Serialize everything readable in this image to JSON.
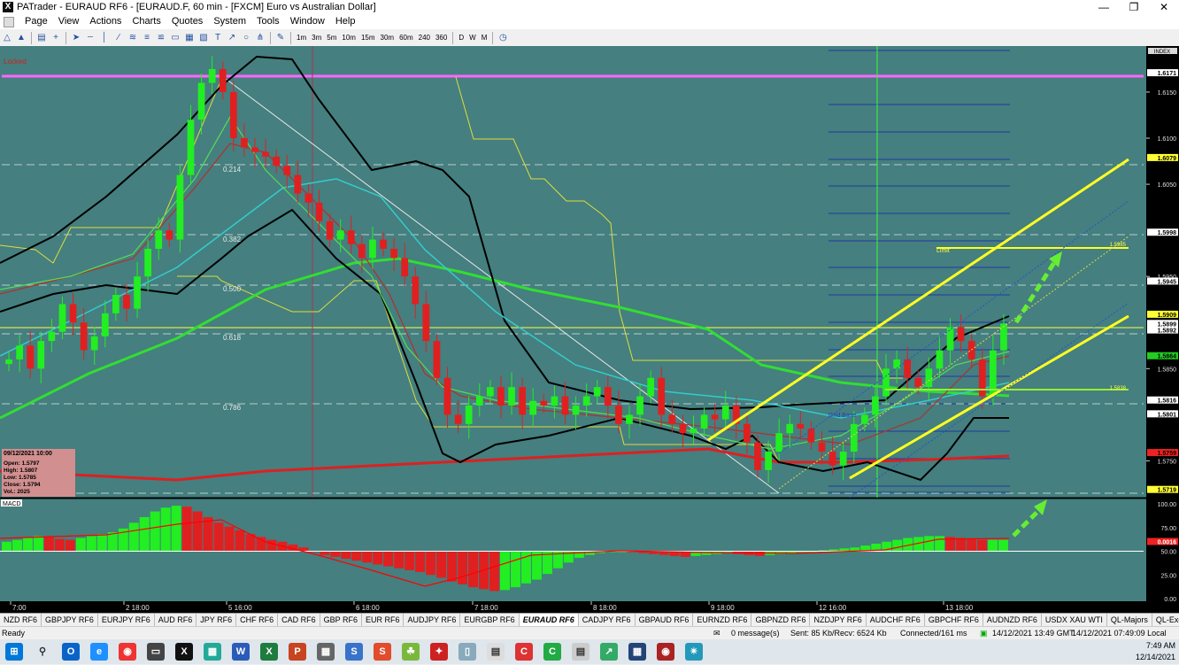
{
  "window": {
    "title": "PATrader - EURAUD RF6 - [EURAUD.F, 60 min - [FXCM] Euro vs Australian Dollar]"
  },
  "menu": [
    "Page",
    "View",
    "Actions",
    "Charts",
    "Quotes",
    "System",
    "Tools",
    "Window",
    "Help"
  ],
  "toolbar": {
    "timeframes": [
      "1m",
      "3m",
      "5m",
      "10m",
      "15m",
      "30m",
      "60m",
      "240",
      "360",
      "D",
      "W",
      "M"
    ]
  },
  "colors": {
    "chart_bg": "#457f7f",
    "bull": "#22ee22",
    "bear": "#e02020",
    "bollinger": "#000000",
    "ma_green": "#33dd33",
    "ma_red": "#dd2020",
    "channel": "#ffff22",
    "macd_line": "#ff0000"
  },
  "chart_data": {
    "type": "candlestick",
    "symbol": "EURAUD.F",
    "timeframe": "60 min",
    "ylim": [
      1.5712,
      1.6198
    ],
    "price_ticks": [
      "1.6150",
      "1.6100",
      "1.6050",
      "1.5950",
      "1.5850",
      "1.5750"
    ],
    "x_ticks": [
      "7:00",
      "2 18:00",
      "5 16:00",
      "6 18:00",
      "7 18:00",
      "8 18:00",
      "9 18:00",
      "12 16:00",
      "13 18:00"
    ],
    "badges": [
      {
        "value": "1.6171",
        "bg": "#ffffff"
      },
      {
        "value": "1.6079",
        "bg": "#ffff33"
      },
      {
        "value": "1.5998",
        "bg": "#ffffff"
      },
      {
        "value": "1.5945",
        "bg": "#ffffff"
      },
      {
        "value": "1.5909",
        "bg": "#ffff33"
      },
      {
        "value": "1.5899",
        "bg": "#ffffff"
      },
      {
        "value": "1.5892",
        "bg": "#ffffff"
      },
      {
        "value": "1.5864",
        "bg": "#22cc22"
      },
      {
        "value": "1.5816",
        "bg": "#ffffff"
      },
      {
        "value": "1.5801",
        "bg": "#ffffff"
      },
      {
        "value": "1.5759",
        "bg": "#ee2222"
      },
      {
        "value": "1.5719",
        "bg": "#ffff33"
      }
    ],
    "fib_labels": [
      "0.214",
      "0.382",
      "0.500",
      "0.618",
      "0.786"
    ],
    "level_labels": {
      "limit": "Limit",
      "limit_value": "1.5985",
      "mid_value": "1.5838",
      "grid_base": "Grid Base",
      "locked": "Locked",
      "index": "INDEX"
    },
    "candles": [
      1.586,
      1.5875,
      1.585,
      1.588,
      1.589,
      1.592,
      1.59,
      1.587,
      1.5885,
      1.591,
      1.593,
      1.5915,
      1.595,
      1.598,
      1.6,
      1.599,
      1.606,
      1.612,
      1.616,
      1.6175,
      1.615,
      1.61,
      1.609,
      1.6085,
      1.608,
      1.607,
      1.606,
      1.604,
      1.603,
      1.601,
      1.599,
      1.6,
      1.5985,
      1.597,
      1.599,
      1.598,
      1.597,
      1.595,
      1.592,
      1.588,
      1.584,
      1.58,
      1.579,
      1.581,
      1.582,
      1.583,
      1.581,
      1.583,
      1.58,
      1.5815,
      1.581,
      1.582,
      1.58,
      1.581,
      1.582,
      1.583,
      1.581,
      1.579,
      1.58,
      1.582,
      1.584,
      1.58,
      1.579,
      1.578,
      1.5785,
      1.58,
      1.5795,
      1.581,
      1.579,
      1.577,
      1.574,
      1.576,
      1.578,
      1.579,
      1.5785,
      1.577,
      1.576,
      1.5745,
      1.576,
      1.579,
      1.58,
      1.582,
      1.585,
      1.586,
      1.584,
      1.583,
      1.585,
      1.587,
      1.5895,
      1.588,
      1.586,
      1.582,
      1.587,
      1.5899
    ],
    "ohlc_box": {
      "date": "09/12/2021 10:00",
      "open": "Open: 1.5797",
      "high": "High: 1.5807",
      "low": "Low: 1.5785",
      "close": "Close: 1.5794",
      "vol": "Vol.: 2025"
    },
    "macd": {
      "label": "MACD",
      "ticks": [
        "100.00",
        "75.00",
        "50.00",
        "25.00",
        "0.00"
      ],
      "value": "0.0016",
      "histogram": [
        60,
        62,
        64,
        66,
        65,
        63,
        62,
        64,
        66,
        68,
        70,
        74,
        80,
        86,
        92,
        96,
        98,
        97,
        92,
        86,
        80,
        76,
        72,
        68,
        65,
        62,
        60,
        57,
        54,
        50,
        46,
        44,
        42,
        40,
        38,
        36,
        34,
        32,
        30,
        28,
        25,
        22,
        18,
        15,
        12,
        10,
        8,
        9,
        12,
        16,
        20,
        26,
        32,
        38,
        43,
        46,
        48,
        49,
        50,
        49,
        48,
        47,
        46,
        45,
        44,
        45,
        46,
        47,
        48,
        47,
        46,
        45,
        46,
        47,
        48,
        49,
        50,
        51,
        52,
        53,
        54,
        56,
        58,
        60,
        62,
        64,
        65,
        66,
        66,
        65,
        64,
        63,
        62,
        62,
        62
      ]
    }
  },
  "tabs": [
    "NZD RF6",
    "GBPJPY RF6",
    "EURJPY RF6",
    "AUD RF6",
    "JPY RF6",
    "CHF RF6",
    "CAD RF6",
    "GBP RF6",
    "EUR RF6",
    "AUDJPY RF6",
    "EURGBP RF6",
    "EURAUD RF6",
    "CADJPY RF6",
    "GBPAUD RF6",
    "EURNZD RF6",
    "GBPNZD RF6",
    "NZDJPY RF6",
    "AUDCHF RF6",
    "GBPCHF RF6",
    "AUDNZD RF6",
    "USDX XAU WTI",
    "QL-Majors",
    "QL-Exotics",
    "USDX RF6",
    "Bitcoin",
    "XRPUSDRF6"
  ],
  "active_tab": "EURAUD RF6",
  "status": {
    "left": "Ready",
    "messages": "0 message(s)",
    "sent": "Sent: 85 Kb/Recv: 6524 Kb",
    "connected": "Connected/161 ms",
    "gmt": "14/12/2021 13:49 GMT",
    "local": "14/12/2021 07:49:09 Local"
  },
  "clock": {
    "time": "7:49 AM",
    "date": "12/14/2021"
  }
}
